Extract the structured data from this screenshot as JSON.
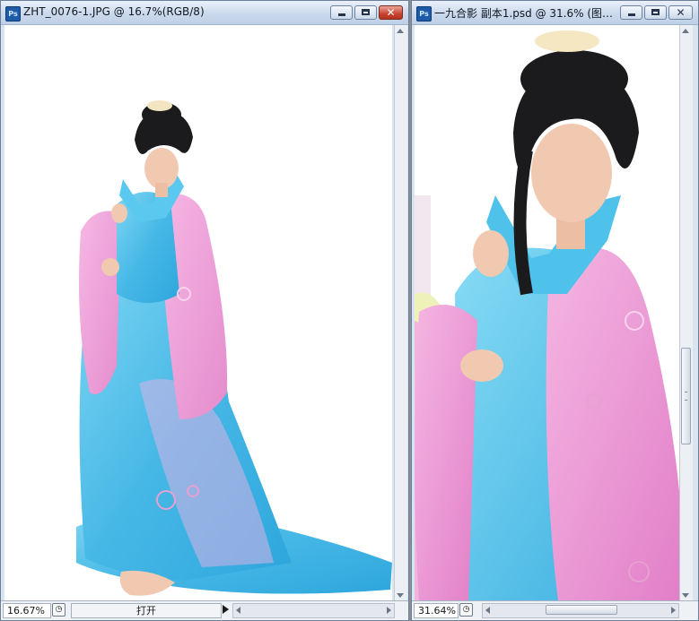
{
  "windows": [
    {
      "title": "ZHT_0076-1.JPG @ 16.7%(RGB/8)",
      "app_icon": "Ps",
      "zoom": "16.67%",
      "status_label": "打开"
    },
    {
      "title": "一九合影 副本1.psd @ 31.6% (图…",
      "app_icon": "Ps",
      "zoom": "31.64%"
    }
  ],
  "colors": {
    "robe_blue": "#56c3e8",
    "robe_pink": "#ee9ad6",
    "hair": "#1b1b1e",
    "skin": "#f1c9b0",
    "titlebar": "#cbd9ec"
  },
  "icons": [
    "photoshop-icon",
    "minimize-icon",
    "maximize-icon",
    "close-icon",
    "document-info-icon",
    "play-icon"
  ]
}
